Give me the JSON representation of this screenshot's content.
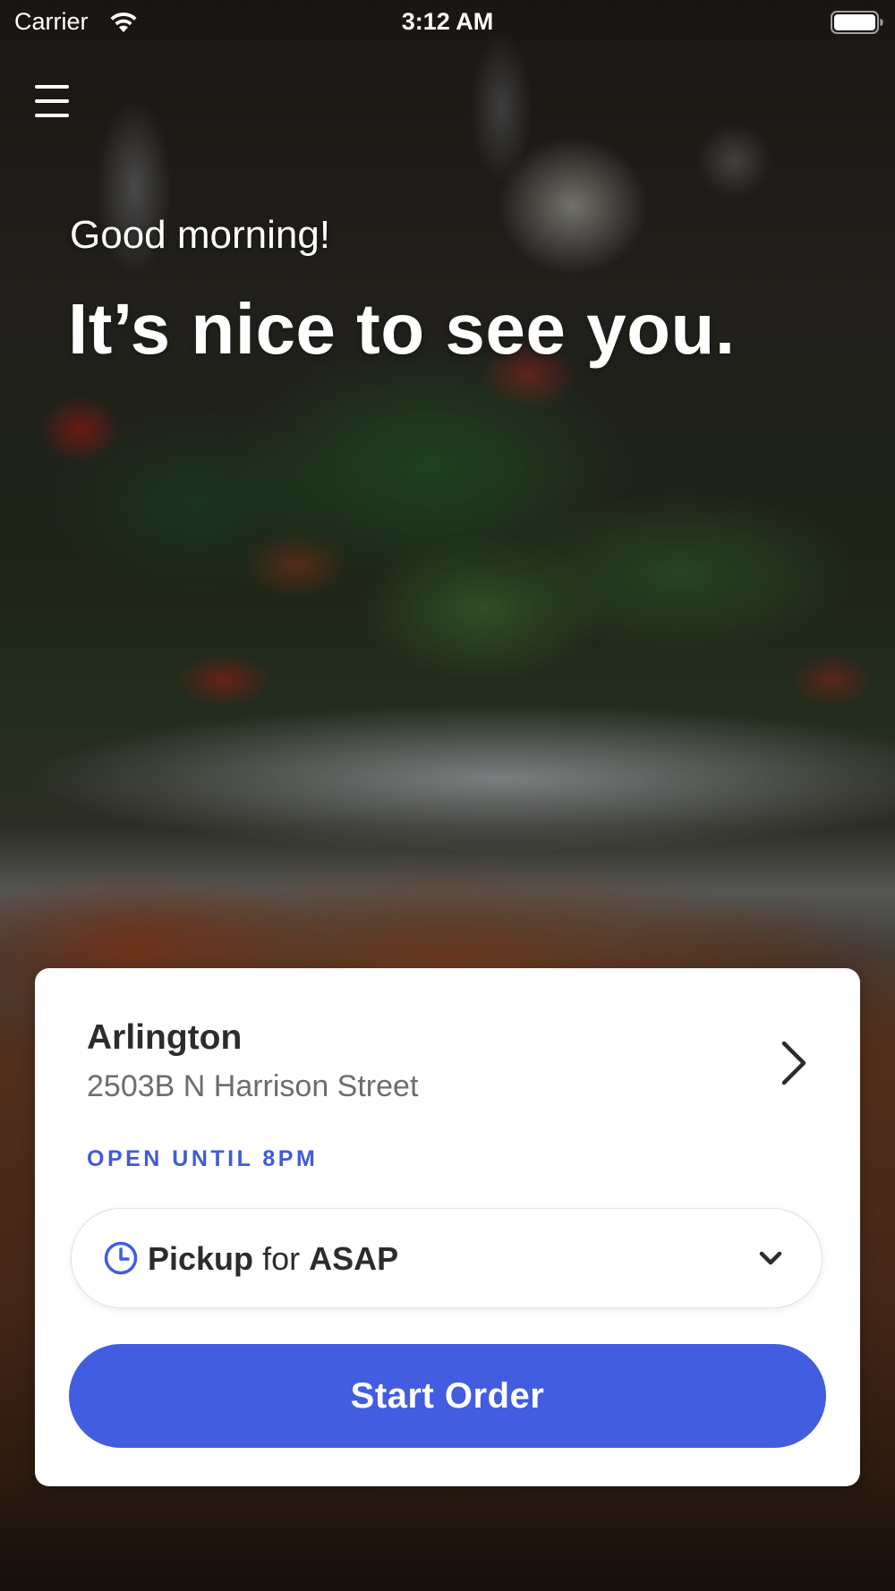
{
  "status_bar": {
    "carrier": "Carrier",
    "time": "3:12 AM"
  },
  "icons": {
    "menu": "hamburger-menu-icon",
    "wifi": "wifi-icon",
    "battery": "battery-icon",
    "location_chevron": "chevron-right-icon",
    "clock": "clock-icon",
    "dropdown": "chevron-down-icon"
  },
  "hero": {
    "greeting": "Good morning!",
    "headline": "It’s nice to see you."
  },
  "location": {
    "name": "Arlington",
    "address": "2503B N Harrison Street",
    "hours": "OPEN UNTIL 8PM"
  },
  "order_mode": {
    "type": "Pickup",
    "connector": "for",
    "time": "ASAP"
  },
  "actions": {
    "start_order": "Start Order"
  },
  "colors": {
    "accent": "#425ddf",
    "hours_text": "#3f5bd8",
    "card_background": "#ffffff"
  }
}
